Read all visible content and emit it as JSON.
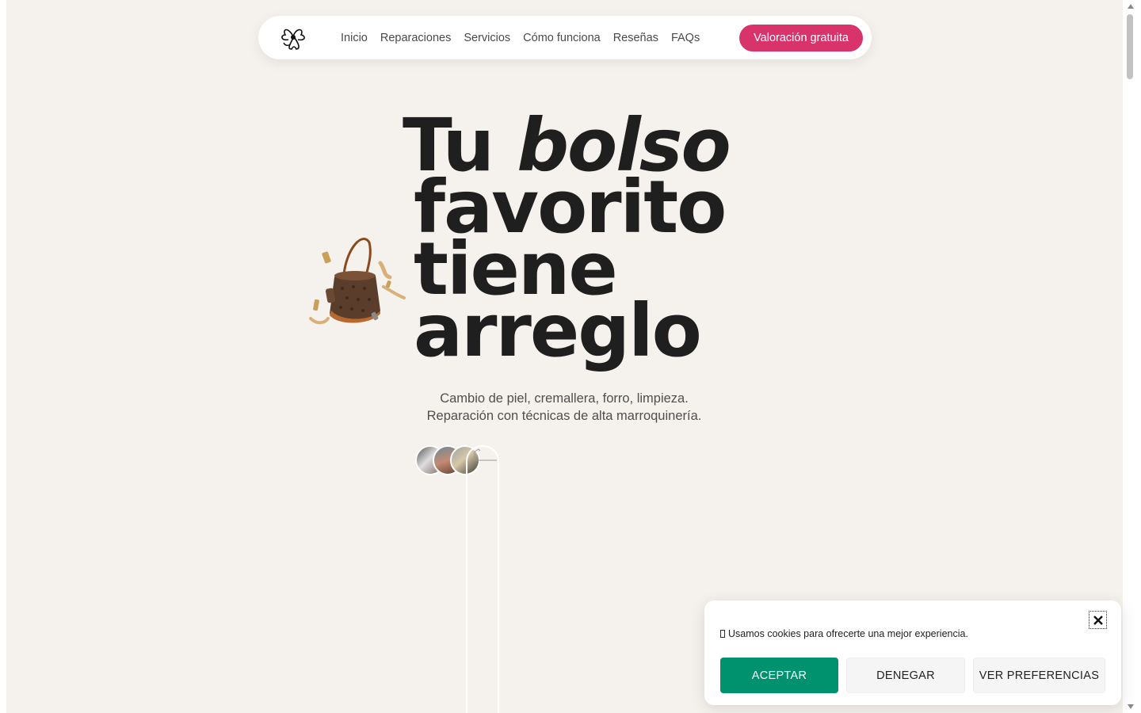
{
  "nav": {
    "logo_icon": "orchid-flower-logo-icon",
    "links": [
      {
        "label": "Inicio"
      },
      {
        "label": "Reparaciones"
      },
      {
        "label": "Servicios"
      },
      {
        "label": "Cómo funciona"
      },
      {
        "label": "Reseñas"
      },
      {
        "label": "FAQs"
      }
    ],
    "cta_label": "Valoración gratuita"
  },
  "hero": {
    "title_line1_plain": "Tu ",
    "title_line1_italic": "bolso",
    "title_line2": "favorito",
    "title_line3": "tiene",
    "title_line4": "arreglo",
    "subtitle_line1": "Cambio de piel, cremallera, forro, limpieza.",
    "subtitle_line2": "Reparación con técnicas de alta marroquinería."
  },
  "cookie_banner": {
    "text": "Usamos cookies para ofrecerte una mejor experiencia.",
    "accept_label": "ACEPTAR",
    "deny_label": "DENEGAR",
    "preferences_label": "VER PREFERENCIAS",
    "close_icon": "close-icon"
  },
  "colors": {
    "accent": "#d8336b",
    "accept": "#00916e",
    "background": "#f5f2ee"
  }
}
